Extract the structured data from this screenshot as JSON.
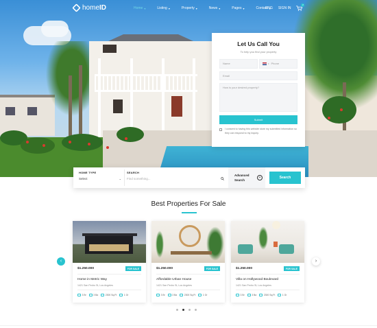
{
  "nav": {
    "logo_prefix": "home",
    "logo_bold": "ID",
    "menu": [
      {
        "label": "Home",
        "active": true
      },
      {
        "label": "Listing",
        "active": false
      },
      {
        "label": "Property",
        "active": false
      },
      {
        "label": "News",
        "active": false
      },
      {
        "label": "Pages",
        "active": false
      },
      {
        "label": "Contact",
        "active": false
      }
    ],
    "currency": "ENG",
    "signin": "SIGN IN",
    "cart_count": "2"
  },
  "call_form": {
    "title": "Let Us Call You",
    "subtitle": "To help you find your property",
    "name_placeholder": "Name",
    "phone_placeholder": "Phone",
    "email_placeholder": "Email",
    "message_placeholder": "How is your desired property?",
    "submit_label": "Submit",
    "consent_text": "I consent to having this website store my submitted information so they can respond to my inquiry."
  },
  "search": {
    "home_type_label": "HOME TYPE",
    "home_type_value": "Select",
    "search_label": "SEARCH",
    "search_placeholder": "Find something...",
    "advanced_line1": "Advanced",
    "advanced_line2": "Search",
    "button_label": "Search"
  },
  "section": {
    "title": "Best Properties For Sale"
  },
  "properties": [
    {
      "price": "$1.250.000",
      "tag": "FOR SALE",
      "name": "Home in Metric Way",
      "address": "1421 San Pedro St, Los Angeles",
      "beds": "3 Br",
      "baths": "3 Ba",
      "area": "2300 Sq.Ft",
      "garage": "1 Gr"
    },
    {
      "price": "$1.250.000",
      "tag": "FOR SALE",
      "name": "Affordable Urban House",
      "address": "1421 San Pedro St, Los Angeles",
      "beds": "3 Br",
      "baths": "3 Ba",
      "area": "2300 Sq.Ft",
      "garage": "1 Gr"
    },
    {
      "price": "$1.250.000",
      "tag": "FOR SALE",
      "name": "Villa on Hollywood Boulevard",
      "address": "1421 San Pedro St, Los Angeles",
      "beds": "3 Br",
      "baths": "3 Ba",
      "area": "2300 Sq.Ft",
      "garage": "1 Gr"
    }
  ],
  "carousel": {
    "prev_icon": "chevron-left",
    "next_icon": "chevron-right",
    "pages": 4,
    "current": 2
  },
  "colors": {
    "accent": "#28c3cf",
    "title": "#222222"
  }
}
